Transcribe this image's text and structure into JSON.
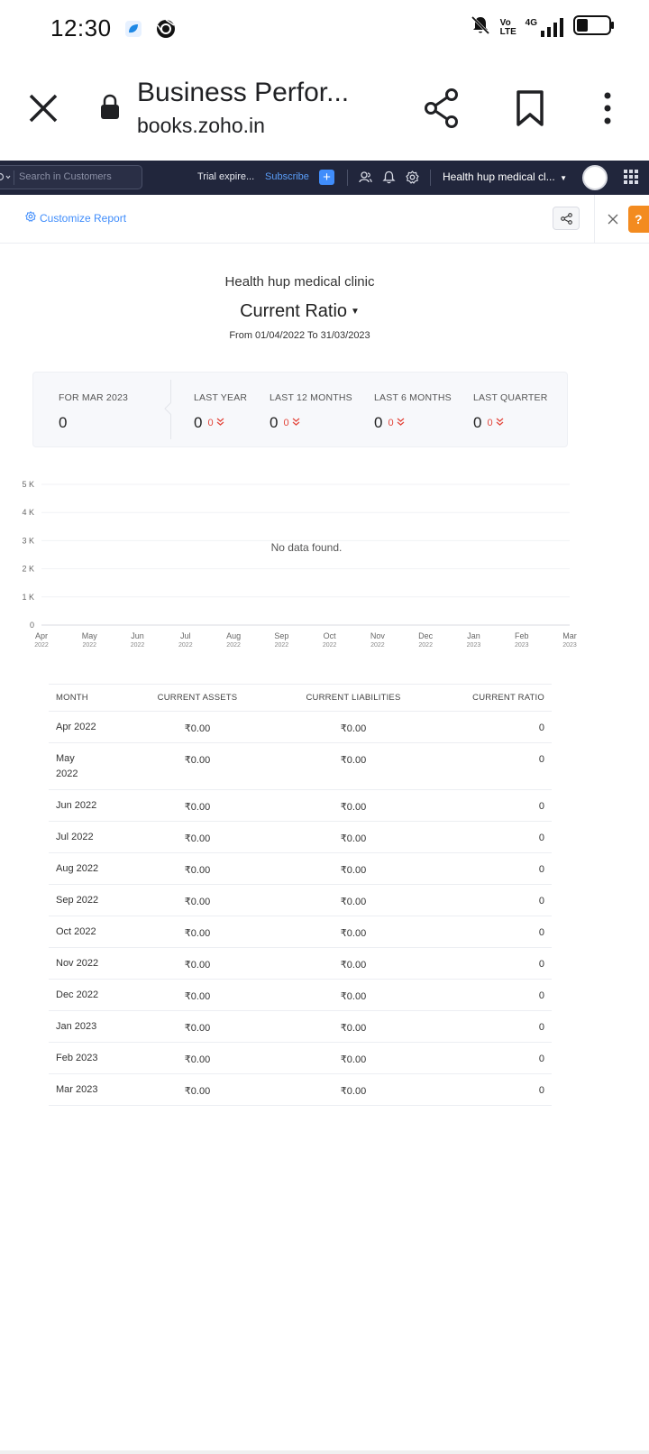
{
  "status_bar": {
    "time": "12:30",
    "volte": "Vo LTE",
    "network": "4G"
  },
  "browser": {
    "title": "Business Perfor...",
    "url": "books.zoho.in"
  },
  "nav": {
    "search_placeholder": "Search in Customers",
    "trial": "Trial expire...",
    "subscribe": "Subscribe",
    "plus": "+",
    "org_name": "Health hup medical cl..."
  },
  "toolbar": {
    "customize": "Customize Report",
    "help": "?"
  },
  "report": {
    "org": "Health hup medical clinic",
    "title": "Current Ratio",
    "range": "From 01/04/2022 To 31/03/2023"
  },
  "summary": [
    {
      "label": "FOR MAR 2023",
      "value": "0",
      "delta": ""
    },
    {
      "label": "LAST YEAR",
      "value": "0",
      "delta": "0"
    },
    {
      "label": "LAST 12 MONTHS",
      "value": "0",
      "delta": "0"
    },
    {
      "label": "LAST 6 MONTHS",
      "value": "0",
      "delta": "0"
    },
    {
      "label": "LAST QUARTER",
      "value": "0",
      "delta": "0"
    }
  ],
  "chart_data": {
    "type": "line",
    "title": "",
    "message": "No data found.",
    "x": [
      "Apr 2022",
      "May 2022",
      "Jun 2022",
      "Jul 2022",
      "Aug 2022",
      "Sep 2022",
      "Oct 2022",
      "Nov 2022",
      "Dec 2022",
      "Jan 2023",
      "Feb 2023",
      "Mar 2023"
    ],
    "x_tick_month": [
      "Apr",
      "May",
      "Jun",
      "Jul",
      "Aug",
      "Sep",
      "Oct",
      "Nov",
      "Dec",
      "Jan",
      "Feb",
      "Mar"
    ],
    "x_tick_year": [
      "2022",
      "2022",
      "2022",
      "2022",
      "2022",
      "2022",
      "2022",
      "2022",
      "2022",
      "2023",
      "2023",
      "2023"
    ],
    "y_ticks": [
      "0",
      "1 K",
      "2 K",
      "3 K",
      "4 K",
      "5 K"
    ],
    "ylim": [
      0,
      5000
    ],
    "series": [],
    "grid": true
  },
  "table": {
    "headers": [
      "MONTH",
      "CURRENT ASSETS",
      "CURRENT LIABILITIES",
      "CURRENT RATIO"
    ],
    "rows": [
      {
        "month": "Apr 2022",
        "assets": "₹0.00",
        "liabilities": "₹0.00",
        "ratio": "0"
      },
      {
        "month": "May 2022",
        "assets": "₹0.00",
        "liabilities": "₹0.00",
        "ratio": "0"
      },
      {
        "month": "Jun 2022",
        "assets": "₹0.00",
        "liabilities": "₹0.00",
        "ratio": "0"
      },
      {
        "month": "Jul 2022",
        "assets": "₹0.00",
        "liabilities": "₹0.00",
        "ratio": "0"
      },
      {
        "month": "Aug 2022",
        "assets": "₹0.00",
        "liabilities": "₹0.00",
        "ratio": "0"
      },
      {
        "month": "Sep 2022",
        "assets": "₹0.00",
        "liabilities": "₹0.00",
        "ratio": "0"
      },
      {
        "month": "Oct 2022",
        "assets": "₹0.00",
        "liabilities": "₹0.00",
        "ratio": "0"
      },
      {
        "month": "Nov 2022",
        "assets": "₹0.00",
        "liabilities": "₹0.00",
        "ratio": "0"
      },
      {
        "month": "Dec 2022",
        "assets": "₹0.00",
        "liabilities": "₹0.00",
        "ratio": "0"
      },
      {
        "month": "Jan 2023",
        "assets": "₹0.00",
        "liabilities": "₹0.00",
        "ratio": "0"
      },
      {
        "month": "Feb 2023",
        "assets": "₹0.00",
        "liabilities": "₹0.00",
        "ratio": "0"
      },
      {
        "month": "Mar 2023",
        "assets": "₹0.00",
        "liabilities": "₹0.00",
        "ratio": "0"
      }
    ]
  },
  "colors": {
    "nav_bg": "#21263c",
    "accent": "#408dfb",
    "help_orange": "#f38b20",
    "negative": "#e3473c"
  }
}
